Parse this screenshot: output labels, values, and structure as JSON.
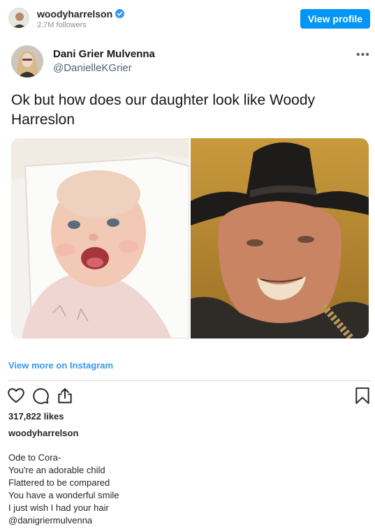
{
  "header": {
    "username": "woodyharrelson",
    "followers": "2.7M followers",
    "view_profile_label": "View profile",
    "verified_color": "#3897f0",
    "button_color": "#0095f6"
  },
  "tweet": {
    "display_name": "Dani Grier Mulvenna",
    "handle": "@DanielleKGrier",
    "more_label": "•••",
    "text": "Ok but how does our daughter look like Woody Harreslon",
    "images": [
      "baby-photo",
      "woody-harrelson-cowboy-hat-photo"
    ]
  },
  "view_more_label": "View more on Instagram",
  "actions": {
    "icons": [
      "heart-icon",
      "comment-icon",
      "share-icon",
      "bookmark-icon"
    ]
  },
  "likes": "317,822 likes",
  "caption": {
    "username": "woodyharrelson",
    "lines": [
      "Ode to Cora-",
      "You're an adorable child",
      "Flattered to be compared",
      "You have a wonderful smile",
      "I just wish I had your hair",
      "@danigriermulvenna"
    ]
  }
}
